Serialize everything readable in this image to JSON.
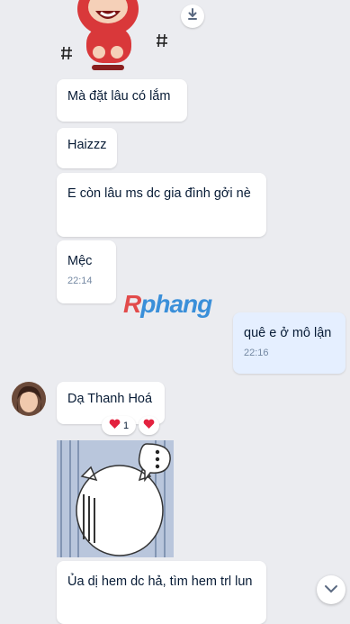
{
  "messages": [
    {
      "text": "Mà đặt lâu có lắm"
    },
    {
      "text": "Haizzz"
    },
    {
      "text": "E còn lâu ms dc gia đình gởi nè"
    },
    {
      "text": "Mệc",
      "time": "22:14"
    },
    {
      "text": "quê e ở mô lận",
      "time": "22:16"
    },
    {
      "text": "Dạ Thanh Hoá"
    },
    {
      "text": "Ủa dị hem dc hả, tìm hem trl lun"
    }
  ],
  "reaction": {
    "count": "1"
  },
  "watermark": {
    "r": "R",
    "rest": "phang"
  },
  "icons": {
    "download": "download-icon",
    "heart": "heart-icon",
    "scroll": "chevron-down-icon"
  },
  "colors": {
    "background": "#ebecf0",
    "bubble_received": "#ffffff",
    "bubble_sent": "#e5efff",
    "heart": "#e3223f"
  }
}
